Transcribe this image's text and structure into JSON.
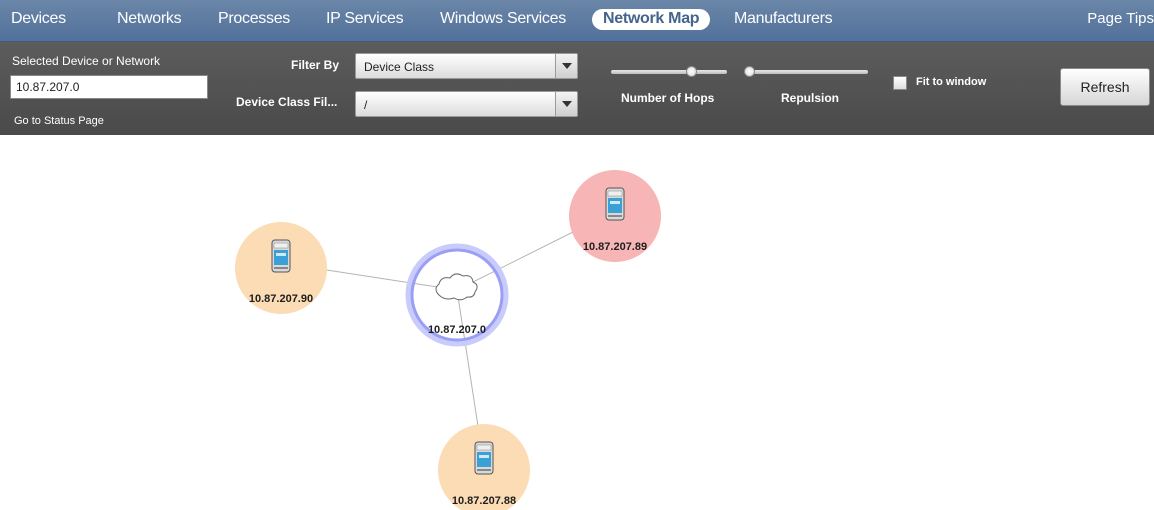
{
  "nav": {
    "items": [
      {
        "label": "Devices",
        "active": false
      },
      {
        "label": "Networks",
        "active": false
      },
      {
        "label": "Processes",
        "active": false
      },
      {
        "label": "IP Services",
        "active": false
      },
      {
        "label": "Windows Services",
        "active": false
      },
      {
        "label": "Network Map",
        "active": true
      },
      {
        "label": "Manufacturers",
        "active": false
      }
    ],
    "page_tips": "Page Tips"
  },
  "toolbar": {
    "selected_label": "Selected Device or Network",
    "selected_value": "10.87.207.0",
    "go_to_status": "Go to Status Page",
    "filter_by_label": "Filter By",
    "filter_by_value": "Device Class",
    "device_class_filter_label": "Device Class Fil...",
    "device_class_filter_value": "/",
    "hops_label": "Number of Hops",
    "hops_level": 0.7,
    "repulsion_label": "Repulsion",
    "repulsion_level": 0.05,
    "fit_to_window_label": "Fit to window",
    "fit_to_window_checked": false,
    "refresh_label": "Refresh"
  },
  "map": {
    "nodes": [
      {
        "id": "net",
        "label": "10.87.207.0",
        "kind": "network",
        "selected": true
      },
      {
        "id": "d90",
        "label": "10.87.207.90",
        "kind": "device",
        "status": "warning"
      },
      {
        "id": "d89",
        "label": "10.87.207.89",
        "kind": "device",
        "status": "error"
      },
      {
        "id": "d88",
        "label": "10.87.207.88",
        "kind": "device",
        "status": "warning"
      }
    ],
    "edges": [
      [
        "net",
        "d90"
      ],
      [
        "net",
        "d89"
      ],
      [
        "net",
        "d88"
      ]
    ],
    "colors": {
      "warning": "#fbdcb4",
      "error": "#f7b5b5",
      "selected_ring": "#9a9ff5",
      "edge": "#b4b4b4"
    }
  }
}
